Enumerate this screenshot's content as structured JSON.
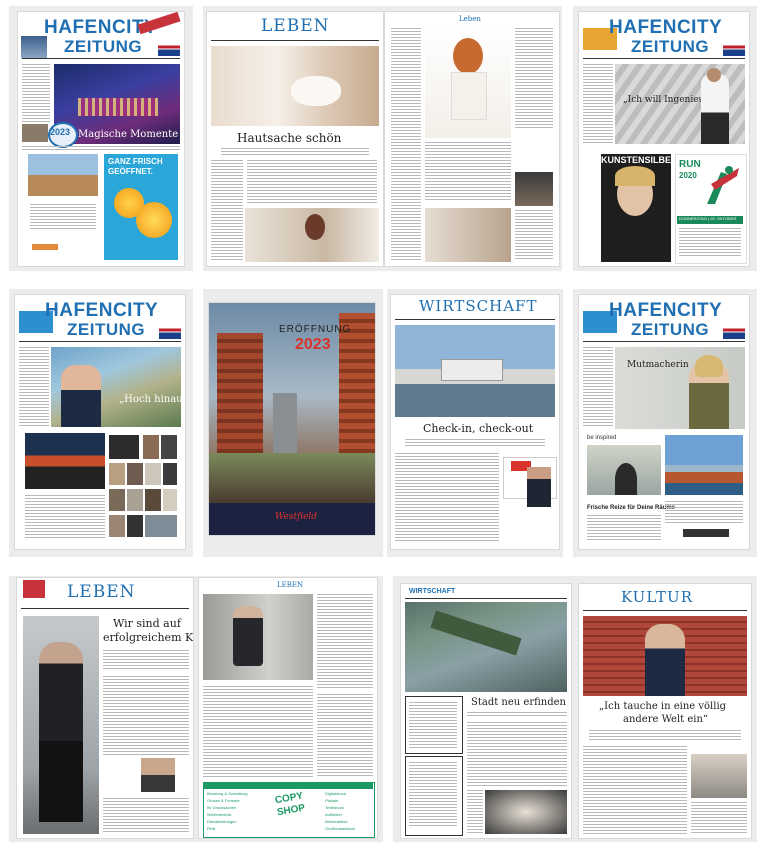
{
  "tile1": {
    "masthead_line1": "HAFENCITY",
    "masthead_line2": "ZEITUNG",
    "year_badge": "2023",
    "cover_caption": "Magische Momente",
    "ad_headline_1": "GANZ FRISCH",
    "ad_headline_2": "GEÖFFNET."
  },
  "tile2": {
    "section": "LEBEN",
    "headline": "Hautsache schön",
    "right_col_title": "Leben"
  },
  "tile3": {
    "masthead_line1": "HAFENCITY",
    "masthead_line2": "ZEITUNG",
    "cover_quote": "„Ich will Ingenieure",
    "ad_left_title": "KUNSTENSILBER",
    "ad_right_title_1": "RUN",
    "ad_right_title_2": "2020",
    "ad_right_strip": "DONNERSTAG | 29. OKTOBER"
  },
  "tile4": {
    "masthead_line1": "HAFENCITY",
    "masthead_line2": "ZEITUNG",
    "headline": "„Hoch hinaus"
  },
  "tile5": {
    "title_line1": "ERÖFFNUNG",
    "title_line2": "2023",
    "brand": "Westfield"
  },
  "tile6": {
    "section": "WIRTSCHAFT",
    "headline": "Check-in, check-out"
  },
  "tile7": {
    "masthead_line1": "HAFENCITY",
    "masthead_line2": "ZEITUNG",
    "headline": "Mutmacherin",
    "ad_label": "be inspired",
    "ad_headline": "Frische Reize für Deine Räume"
  },
  "tile8": {
    "section": "LEBEN",
    "headline_1": "Wir sind auf",
    "headline_2": "erfolgreichem Kurs!",
    "right_section": "LEBEN",
    "ad_logo_1": "COPY",
    "ad_logo_2": "SHOP",
    "ad_items_left": [
      "Beratung & Gestaltung",
      "Grosse & Formate",
      "Ihr Drucksachen",
      "Werbetechnik",
      "Dienstleistungen",
      "Plott"
    ],
    "ad_items_right": [
      "Digitaldruck",
      "Plakate",
      "Textildruck",
      "Aufkleber",
      "Werbeartikel",
      "Großformatdruck"
    ]
  },
  "tile9": {
    "left_section": "WIRTSCHAFT",
    "left_headline": "Stadt neu erfinden",
    "right_section": "KULTUR",
    "right_headline_1": "„Ich tauche in eine völlig",
    "right_headline_2": "andere Welt ein“"
  },
  "colors": {
    "brand_blue": "#1f6fb2",
    "tile_bg": "#ececec",
    "kultur_red": "#b1473a"
  }
}
